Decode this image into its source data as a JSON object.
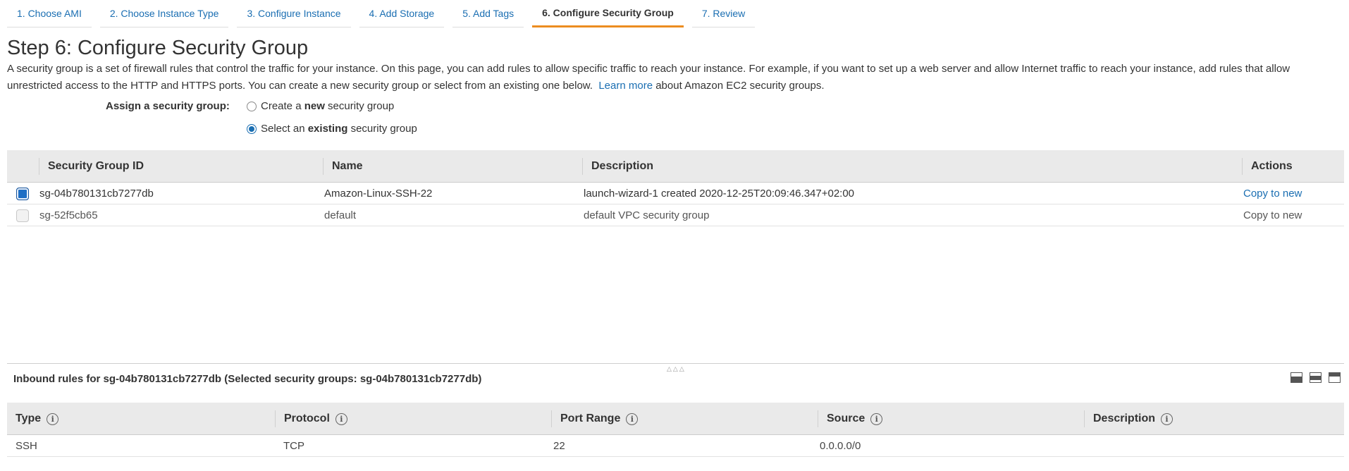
{
  "tabs": [
    {
      "label": "1. Choose AMI"
    },
    {
      "label": "2. Choose Instance Type"
    },
    {
      "label": "3. Configure Instance"
    },
    {
      "label": "4. Add Storage"
    },
    {
      "label": "5. Add Tags"
    },
    {
      "label": "6. Configure Security Group"
    },
    {
      "label": "7. Review"
    }
  ],
  "active_tab_index": 5,
  "page": {
    "title": "Step 6: Configure Security Group",
    "intro": "A security group is a set of firewall rules that control the traffic for your instance. On this page, you can add rules to allow specific traffic to reach your instance. For example, if you want to set up a web server and allow Internet traffic to reach your instance, add rules that allow unrestricted access to the HTTP and HTTPS ports. You can create a new security group or select from an existing one below.",
    "learn_more": "Learn more",
    "intro_suffix": " about Amazon EC2 security groups."
  },
  "assign": {
    "label": "Assign a security group:",
    "options": [
      {
        "pre": "Create a ",
        "bold": "new",
        "post": " security group",
        "selected": false
      },
      {
        "pre": "Select an ",
        "bold": "existing",
        "post": " security group",
        "selected": true
      }
    ]
  },
  "sg_table": {
    "columns": [
      "Security Group ID",
      "Name",
      "Description",
      "Actions"
    ],
    "rows": [
      {
        "checked": true,
        "id": "sg-04b780131cb7277db",
        "name": "Amazon-Linux-SSH-22",
        "description": "launch-wizard-1 created 2020-12-25T20:09:46.347+02:00",
        "action": "Copy to new"
      },
      {
        "checked": false,
        "id": "sg-52f5cb65",
        "name": "default",
        "description": "default VPC security group",
        "action": "Copy to new"
      }
    ]
  },
  "inbound": {
    "title": "Inbound rules for sg-04b780131cb7277db (Selected security groups: sg-04b780131cb7277db)",
    "columns": [
      "Type",
      "Protocol",
      "Port Range",
      "Source",
      "Description"
    ],
    "rows": [
      {
        "type": "SSH",
        "protocol": "TCP",
        "port_range": "22",
        "source": "0.0.0.0/0",
        "description": ""
      }
    ]
  },
  "colors": {
    "link": "#1a6eb2",
    "active_tab_underline": "#ec8c20",
    "checkbox_selected": "#1f6fc5"
  }
}
